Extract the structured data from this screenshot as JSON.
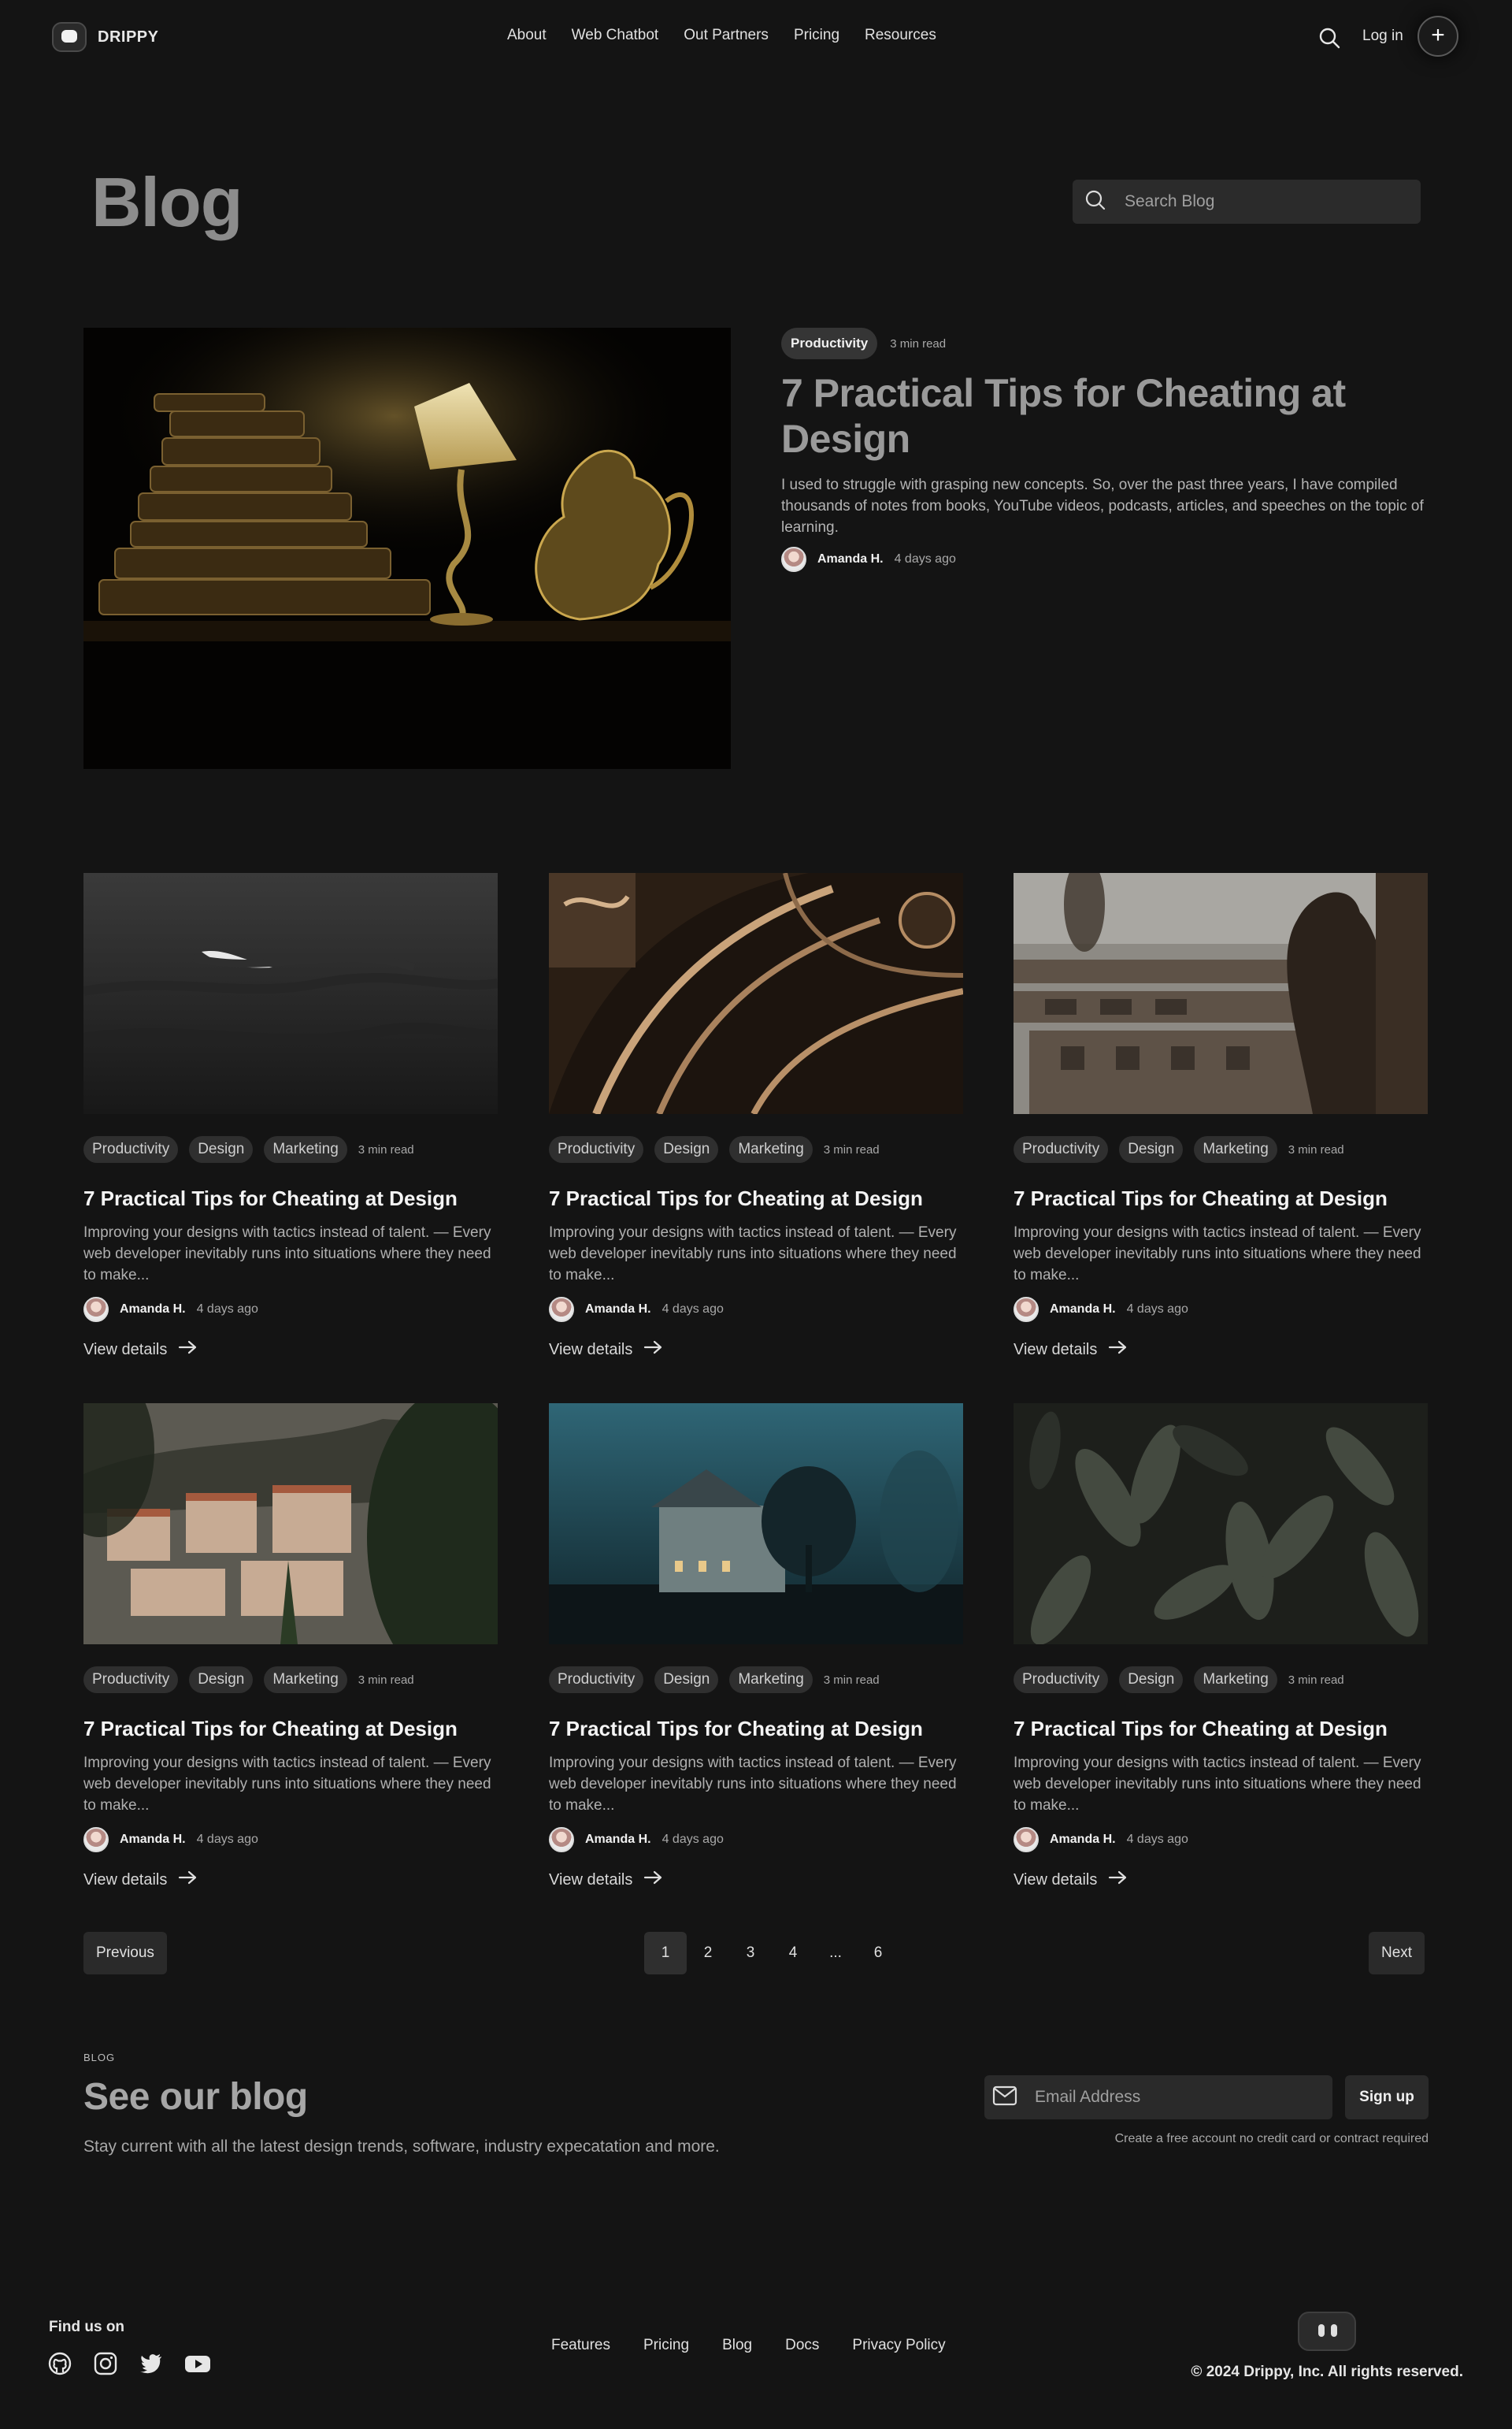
{
  "nav": {
    "brand": "DRIPPY",
    "menu": [
      "About",
      "Web Chatbot",
      "Out Partners",
      "Pricing",
      "Resources"
    ],
    "login": "Log in",
    "plus": "+"
  },
  "header": {
    "title": "Blog",
    "search_placeholder": "Search Blog"
  },
  "featured": {
    "tag": "Productivity",
    "read_time": "3 min read",
    "title": "7 Practical Tips for Cheating at Design",
    "description": "I used to struggle with grasping new concepts. So, over the past three years, I have compiled thousands of notes from books, YouTube videos, podcasts, articles, and speeches on the topic of learning.",
    "author": "Amanda H.",
    "date": "4 days ago"
  },
  "cards": [
    {
      "tags": [
        "Productivity",
        "Design",
        "Marketing"
      ],
      "read_time": "3 min read",
      "title": "7 Practical Tips for Cheating at Design",
      "description": "Improving your designs with tactics instead of talent. — Every web developer inevitably runs into situations where they need to make...",
      "author": "Amanda H.",
      "date": "4 days ago",
      "cta": "View details"
    },
    {
      "tags": [
        "Productivity",
        "Design",
        "Marketing"
      ],
      "read_time": "3 min read",
      "title": "7 Practical Tips for Cheating at Design",
      "description": "Improving your designs with tactics instead of talent. — Every web developer inevitably runs into situations where they need to make...",
      "author": "Amanda H.",
      "date": "4 days ago",
      "cta": "View details"
    },
    {
      "tags": [
        "Productivity",
        "Design",
        "Marketing"
      ],
      "read_time": "3 min read",
      "title": "7 Practical Tips for Cheating at Design",
      "description": "Improving your designs with tactics instead of talent. — Every web developer inevitably runs into situations where they need to make...",
      "author": "Amanda H.",
      "date": "4 days ago",
      "cta": "View details"
    },
    {
      "tags": [
        "Productivity",
        "Design",
        "Marketing"
      ],
      "read_time": "3 min read",
      "title": "7 Practical Tips for Cheating at Design",
      "description": "Improving your designs with tactics instead of talent. — Every web developer inevitably runs into situations where they need to make...",
      "author": "Amanda H.",
      "date": "4 days ago",
      "cta": "View details"
    },
    {
      "tags": [
        "Productivity",
        "Design",
        "Marketing"
      ],
      "read_time": "3 min read",
      "title": "7 Practical Tips for Cheating at Design",
      "description": "Improving your designs with tactics instead of talent. — Every web developer inevitably runs into situations where they need to make...",
      "author": "Amanda H.",
      "date": "4 days ago",
      "cta": "View details"
    },
    {
      "tags": [
        "Productivity",
        "Design",
        "Marketing"
      ],
      "read_time": "3 min read",
      "title": "7 Practical Tips for Cheating at Design",
      "description": "Improving your designs with tactics instead of talent. — Every web developer inevitably runs into situations where they need to make...",
      "author": "Amanda H.",
      "date": "4 days ago",
      "cta": "View details"
    }
  ],
  "pagination": {
    "previous": "Previous",
    "next": "Next",
    "pages": [
      "1",
      "2",
      "3",
      "4",
      "...",
      "6"
    ],
    "current": "1"
  },
  "newsletter": {
    "kicker": "BLOG",
    "title": "See our blog",
    "description": "Stay current with all the latest design trends, software, industry expecatation and more.",
    "email_placeholder": "Email Address",
    "button": "Sign up",
    "note": "Create a free account no credit card or contract required"
  },
  "footer": {
    "find_us": "Find us on",
    "socials": [
      "github-icon",
      "instagram-icon",
      "twitter-icon",
      "youtube-icon"
    ],
    "links": [
      "Features",
      "Pricing",
      "Blog",
      "Docs",
      "Privacy Policy"
    ],
    "copyright": "© 2024 Drippy, Inc. All rights reserved."
  }
}
